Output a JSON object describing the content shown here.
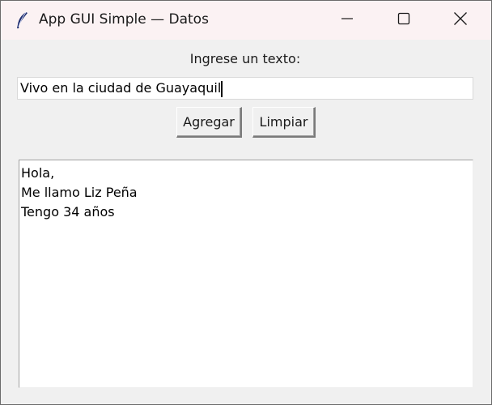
{
  "window": {
    "title": "App GUI Simple — Datos",
    "icon": "tk-feather-icon",
    "controls": {
      "minimize": "minimize-icon",
      "maximize": "maximize-icon",
      "close": "close-icon"
    }
  },
  "form": {
    "prompt_label": "Ingrese un texto:",
    "entry_value": "Vivo en la ciudad de Guayaquil",
    "add_button": "Agregar",
    "clear_button": "Limpiar"
  },
  "output": {
    "lines": [
      "Hola,",
      "Me llamo Liz Peña",
      "Tengo 34 años"
    ]
  }
}
